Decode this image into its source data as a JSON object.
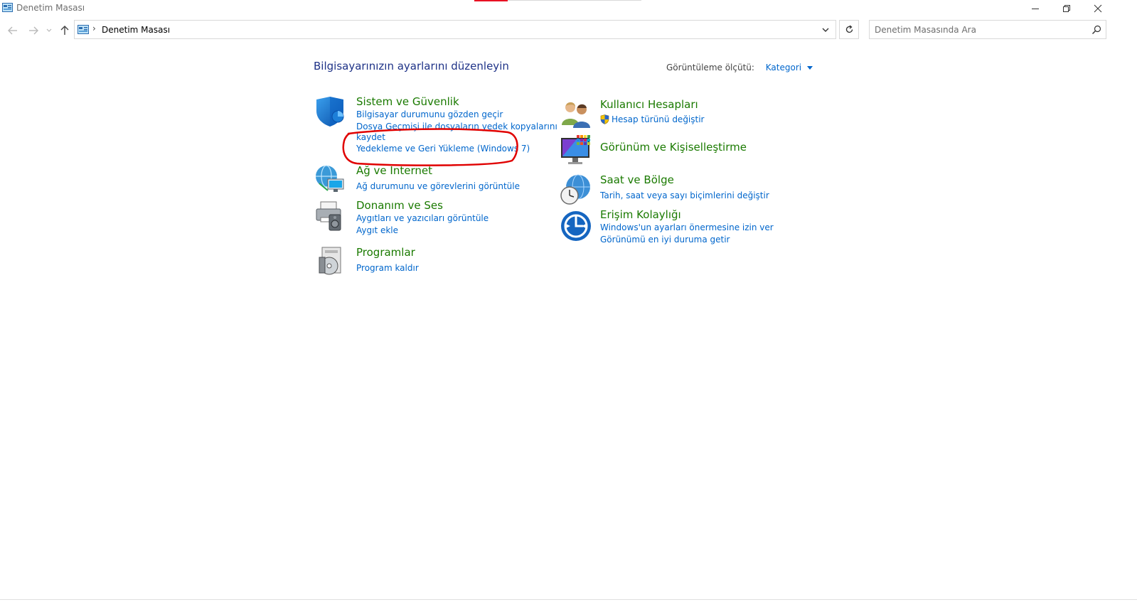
{
  "window": {
    "title": "Denetim Masası",
    "accent_color": "#e81123"
  },
  "window_controls": {
    "minimize_icon": "minimize-icon",
    "restore_icon": "restore-icon",
    "close_icon": "close-icon"
  },
  "nav": {
    "back_icon": "arrow-left-icon",
    "forward_icon": "arrow-right-icon",
    "recent_icon": "chevron-down-icon",
    "up_icon": "arrow-up-icon"
  },
  "address": {
    "separator": "›",
    "path": "Denetim Masası"
  },
  "search": {
    "placeholder": "Denetim Masasında Ara"
  },
  "main": {
    "title": "Bilgisayarınızın ayarlarını düzenleyin",
    "view_by_label": "Görüntüleme ölçütü:",
    "view_by_value": "Kategori",
    "title_color": "#1e3287",
    "category_color": "#1a7a00",
    "link_color": "#0066cc"
  },
  "categories": {
    "system_security": {
      "title": "Sistem ve Güvenlik",
      "icon": "shield-icon",
      "links": [
        "Bilgisayar durumunu gözden geçir",
        "Dosya Geçmişi ile dosyaların yedek kopyalarını",
        "kaydet",
        "Yedekleme ve Geri Yükleme (Windows 7)"
      ]
    },
    "network": {
      "title": "Ağ ve Internet",
      "icon": "network-globe-icon",
      "links": [
        "Ağ durumunu ve görevlerini görüntüle"
      ]
    },
    "hardware": {
      "title": "Donanım ve Ses",
      "icon": "printer-speaker-icon",
      "links": [
        "Aygıtları ve yazıcıları görüntüle",
        "Aygıt ekle"
      ]
    },
    "programs": {
      "title": "Programlar",
      "icon": "programs-disc-icon",
      "links": [
        "Program kaldır"
      ]
    },
    "user_accounts": {
      "title": "Kullanıcı Hesapları",
      "icon": "users-icon",
      "links": [
        "Hesap türünü değiştir"
      ]
    },
    "appearance": {
      "title": "Görünüm ve Kişiselleştirme",
      "icon": "monitor-color-icon",
      "links": []
    },
    "clock_region": {
      "title": "Saat ve Bölge",
      "icon": "clock-globe-icon",
      "links": [
        "Tarih, saat veya sayı biçimlerini değiştir"
      ]
    },
    "ease_of_access": {
      "title": "Erişim Kolaylığı",
      "icon": "accessibility-icon",
      "links": [
        "Windows'un ayarları önermesine izin ver",
        "Görünümü en iyi duruma getir"
      ]
    }
  },
  "annotation": {
    "color": "#e00000",
    "shape": "ellipse-highlight"
  }
}
